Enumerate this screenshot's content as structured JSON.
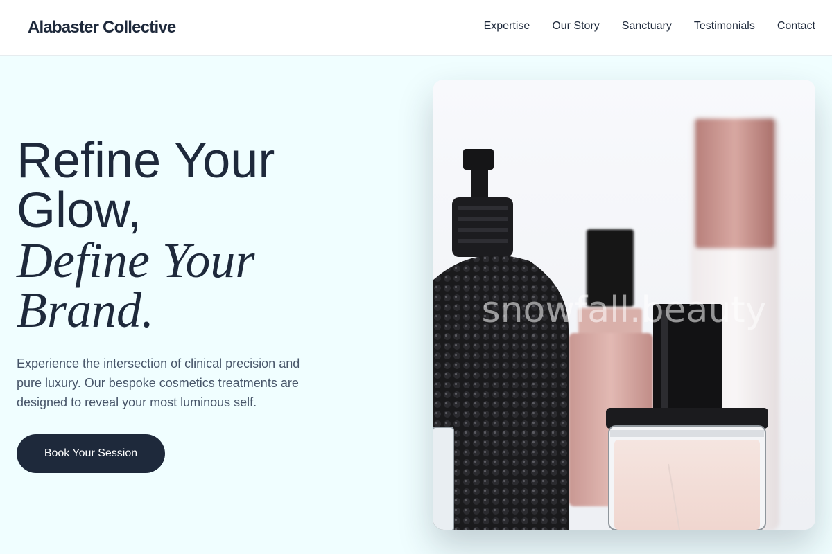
{
  "nav": {
    "brand": "Alabaster Collective",
    "links": [
      "Expertise",
      "Our Story",
      "Sanctuary",
      "Testimonials",
      "Contact"
    ]
  },
  "hero": {
    "title_line1": "Refine Your",
    "title_line2": "Glow,",
    "title_italic_line1": "Define Your",
    "title_italic_line2": "Brand.",
    "description": "Experience the intersection of clinical precision and pure luxury. Our bespoke cosmetics treatments are designed to reveal your most luminous self.",
    "cta_label": "Book Your Session",
    "image": {
      "subject": "perfume-bottles-photo",
      "watermark": "snowfall.beauty"
    }
  },
  "colors": {
    "page_background": "#f0feff",
    "nav_background": "#ffffff",
    "primary_dark": "#1e293b",
    "body_text": "#475569",
    "rose_gold": "#c9918a"
  }
}
